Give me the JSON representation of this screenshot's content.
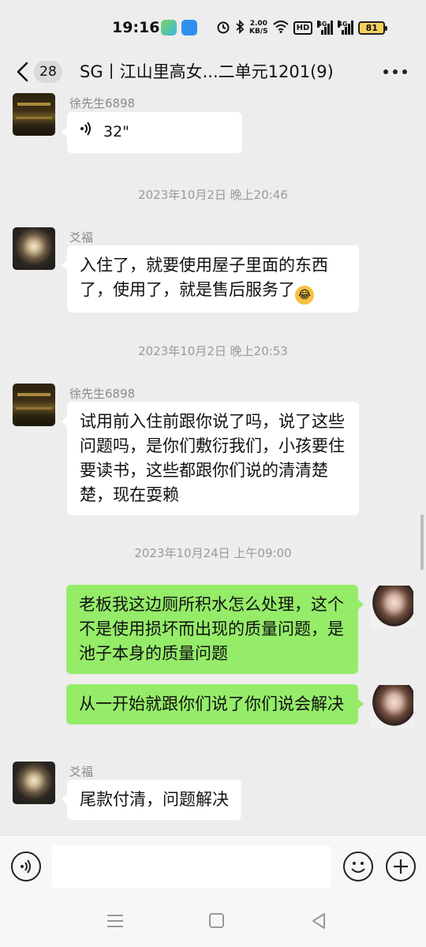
{
  "status_bar": {
    "time": "19:16",
    "net_speed_value": "2.00",
    "net_speed_unit": "KB/S",
    "hd_label": "HD",
    "signal1_label": "4G",
    "signal2_label": "4G",
    "battery": "81",
    "icons": [
      "app-icon",
      "app-icon",
      "alarm-icon",
      "bluetooth-icon",
      "wifi-icon",
      "signal-icon",
      "signal-icon",
      "battery-icon"
    ]
  },
  "navbar": {
    "unread_count": "28",
    "title": "SG丨江山里高女...二单元1201(9)"
  },
  "messages": {
    "m1": {
      "sender": "徐先生6898",
      "voice_duration": "32\""
    },
    "t1": "2023年10月2日 晚上20:46",
    "m2": {
      "sender": "爻福",
      "text": "入住了，就要使用屋子里面的东西了，使用了，就是售后服务了"
    },
    "t2": "2023年10月2日 晚上20:53",
    "m3": {
      "sender": "徐先生6898",
      "text": "试用前入住前跟你说了吗，说了这些问题吗，是你们敷衍我们，小孩要住要读书，这些都跟你们说的清清楚楚，现在耍赖"
    },
    "t3": "2023年10月24日 上午09:00",
    "m4": {
      "text": "老板我这边厕所积水怎么处理，这个不是使用损坏而出现的质量问题，是池子本身的质量问题"
    },
    "m5": {
      "text": "从一开始就跟你们说了你们说会解决"
    },
    "m6": {
      "sender": "爻福",
      "text": "尾款付清，问题解决"
    }
  },
  "colors": {
    "background": "#ededed",
    "bubble_in": "#ffffff",
    "bubble_out": "#95ec69"
  }
}
